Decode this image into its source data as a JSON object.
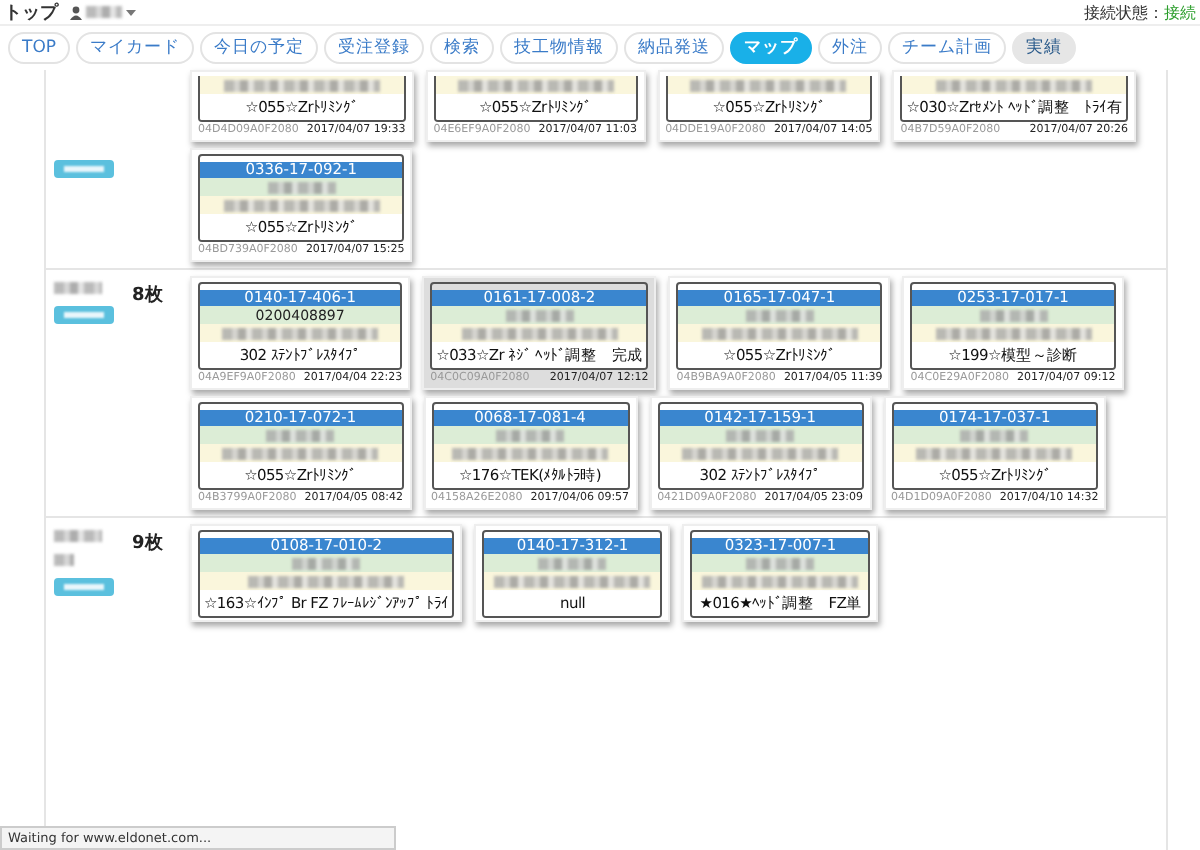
{
  "header": {
    "title": "トップ",
    "status_label": "接続状態：",
    "status_value": "接続"
  },
  "tabs": [
    {
      "label": "TOP",
      "selected": false,
      "highlighted": false
    },
    {
      "label": "マイカード",
      "selected": false,
      "highlighted": false
    },
    {
      "label": "今日の予定",
      "selected": false,
      "highlighted": false
    },
    {
      "label": "受注登録",
      "selected": false,
      "highlighted": false
    },
    {
      "label": "検索",
      "selected": false,
      "highlighted": false
    },
    {
      "label": "技工物情報",
      "selected": false,
      "highlighted": false
    },
    {
      "label": "納品発送",
      "selected": false,
      "highlighted": false
    },
    {
      "label": "マップ",
      "selected": true,
      "highlighted": false
    },
    {
      "label": "外注",
      "selected": false,
      "highlighted": false
    },
    {
      "label": "チーム計画",
      "selected": false,
      "highlighted": false
    },
    {
      "label": "実績",
      "selected": false,
      "highlighted": true
    }
  ],
  "groups": [
    {
      "cards": [
        {
          "kind": "cut_top",
          "selected": false,
          "work": "☆055☆Zrﾄﾘﾐﾝｸﾞ",
          "code": "04D4D09A0F2080",
          "date": "2017/04/07 19:33"
        },
        {
          "kind": "cut_top",
          "selected": false,
          "work": "☆055☆Zrﾄﾘﾐﾝｸﾞ",
          "code": "04E6EF9A0F2080",
          "date": "2017/04/07 11:03"
        },
        {
          "kind": "cut_top",
          "selected": false,
          "work": "☆055☆Zrﾄﾘﾐﾝｸﾞ",
          "code": "04DDE19A0F2080",
          "date": "2017/04/07 14:05"
        },
        {
          "kind": "cut_top",
          "selected": false,
          "work": "☆030☆Zrｾﾒﾝﾄ ﾍｯﾄﾞ調整　ﾄﾗｲ有",
          "code": "04B7D59A0F2080",
          "date": "2017/04/07 20:26"
        },
        {
          "kind": "full",
          "selected": false,
          "number": "0336-17-092-1",
          "work": "☆055☆Zrﾄﾘﾐﾝｸﾞ",
          "code": "04BD739A0F2080",
          "date": "2017/04/07 15:25"
        }
      ]
    },
    {
      "count": "8枚",
      "cards": [
        {
          "kind": "full",
          "selected": false,
          "number": "0140-17-406-1",
          "patient": "0200408897",
          "work": "302 ｽﾃﾝﾄﾌﾞﾚｽﾀｲﾌﾟ",
          "code": "04A9EF9A0F2080",
          "date": "2017/04/04 22:23"
        },
        {
          "kind": "full",
          "selected": true,
          "number": "0161-17-008-2",
          "work": "☆033☆Zr ﾈｼﾞ ﾍｯﾄﾞ調整　完成",
          "code": "04C0C09A0F2080",
          "date": "2017/04/07 12:12"
        },
        {
          "kind": "full",
          "selected": false,
          "number": "0165-17-047-1",
          "work": "☆055☆Zrﾄﾘﾐﾝｸﾞ",
          "code": "04B9BA9A0F2080",
          "date": "2017/04/05 11:39"
        },
        {
          "kind": "full",
          "selected": false,
          "number": "0253-17-017-1",
          "work": "☆199☆模型～診断",
          "code": "04C0E29A0F2080",
          "date": "2017/04/07 09:12"
        },
        {
          "kind": "full",
          "selected": false,
          "number": "0210-17-072-1",
          "work": "☆055☆Zrﾄﾘﾐﾝｸﾞ",
          "code": "04B3799A0F2080",
          "date": "2017/04/05 08:42"
        },
        {
          "kind": "full",
          "selected": false,
          "number": "0068-17-081-4",
          "work": "☆176☆TEK(ﾒﾀﾙﾄﾗ時)",
          "code": "04158A26E2080",
          "date": "2017/04/06 09:57"
        },
        {
          "kind": "full",
          "selected": false,
          "number": "0142-17-159-1",
          "work": "302 ｽﾃﾝﾄﾌﾞﾚｽﾀｲﾌﾟ",
          "code": "0421D09A0F2080",
          "date": "2017/04/05 23:09"
        },
        {
          "kind": "full",
          "selected": false,
          "number": "0174-17-037-1",
          "work": "☆055☆Zrﾄﾘﾐﾝｸﾞ",
          "code": "04D1D09A0F2080",
          "date": "2017/04/10 14:32"
        }
      ]
    },
    {
      "count": "9枚",
      "cards": [
        {
          "kind": "cut_bottom",
          "selected": false,
          "number": "0108-17-010-2",
          "work": "☆163☆ｲﾝﾌﾟ Br FZ ﾌﾚｰﾑﾚｼﾞﾝｱｯﾌﾟ ﾄﾗｲ"
        },
        {
          "kind": "cut_bottom",
          "selected": false,
          "number": "0140-17-312-1",
          "work": "null"
        },
        {
          "kind": "cut_bottom",
          "selected": false,
          "number": "0323-17-007-1",
          "work": "★016★ﾍｯﾄﾞ調整　FZ単"
        }
      ]
    }
  ],
  "status_bar": "Waiting for www.eldonet.com..."
}
